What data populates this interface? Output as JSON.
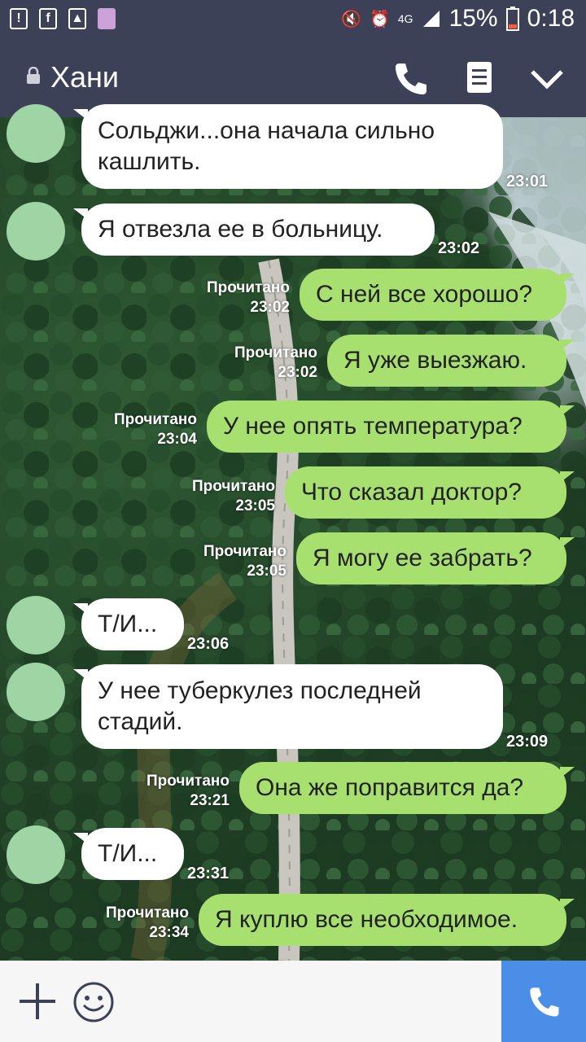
{
  "status_bar": {
    "battery": "15%",
    "time": "0:18",
    "network": "4G"
  },
  "header": {
    "title": "Хани"
  },
  "messages": [
    {
      "dir": "in",
      "text": "Сольджи...она начала сильно кашлить.",
      "time": "23:01"
    },
    {
      "dir": "in",
      "text": "Я отвезла ее в больницу.",
      "time": "23:02"
    },
    {
      "dir": "out",
      "text": "С ней все хорошо?",
      "read": "Прочитано",
      "time": "23:02"
    },
    {
      "dir": "out",
      "text": "Я уже выезжаю.",
      "read": "Прочитано",
      "time": "23:02"
    },
    {
      "dir": "out",
      "text": "У нее опять температура?",
      "read": "Прочитано",
      "time": "23:04"
    },
    {
      "dir": "out",
      "text": "Что сказал доктор?",
      "read": "Прочитано",
      "time": "23:05"
    },
    {
      "dir": "out",
      "text": "Я могу ее забрать?",
      "read": "Прочитано",
      "time": "23:05"
    },
    {
      "dir": "in",
      "text": "Т/И...",
      "time": "23:06"
    },
    {
      "dir": "in",
      "text": "У нее туберкулез последней стадий.",
      "time": "23:09"
    },
    {
      "dir": "out",
      "text": "Она же поправится да?",
      "read": "Прочитано",
      "time": "23:21"
    },
    {
      "dir": "in",
      "text": "Т/И...",
      "time": "23:31"
    },
    {
      "dir": "out",
      "text": "Я куплю все необходимое.",
      "read": "Прочитано",
      "time": "23:34"
    }
  ],
  "colors": {
    "header_bg": "#3d4158",
    "outgoing_bubble": "#a8e070",
    "incoming_bubble": "#ffffff",
    "call_button": "#4a8ee8",
    "avatar": "#9fd4a5"
  },
  "icons": {
    "status_left": [
      "alert-icon",
      "facebook-icon",
      "image-icon",
      "app-thumbnail-icon"
    ],
    "status_right": [
      "mute-vibrate-icon",
      "alarm-icon",
      "network-4g-icon",
      "signal-icon",
      "battery-icon"
    ],
    "header": [
      "lock-icon",
      "phone-icon",
      "notes-icon",
      "chevron-down-icon"
    ],
    "bottom": [
      "plus-icon",
      "emoji-icon",
      "call-icon"
    ]
  }
}
